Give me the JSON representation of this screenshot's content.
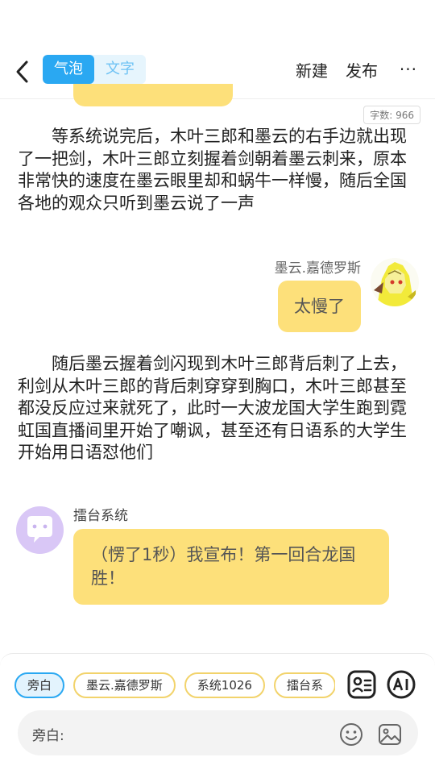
{
  "header": {
    "back_icon": "chevron-left-icon",
    "toggle": {
      "active": "气泡",
      "inactive": "文字"
    },
    "new_label": "新建",
    "publish_label": "发布",
    "more_label": "···"
  },
  "word_count": "字数: 966",
  "narration": [
    "等系统说完后，木叶三郎和墨云的右手边就出现了一把剑，木叶三郎立刻握着剑朝着墨云刺来，原本非常快的速度在墨云眼里却和蜗牛一样慢，随后全国各地的观众只听到墨云说了一声",
    "随后墨云握着剑闪现到木叶三郎背后刺了上去，利剑从木叶三郎的背后刺穿穿到胸口，木叶三郎甚至都没反应过来就死了，此时一大波龙国大学生跑到霓虹国直播间里开始了嘲讽，甚至还有日语系的大学生开始用日语怼他们"
  ],
  "messages": [
    {
      "name": "墨云.嘉德罗斯",
      "text": "太慢了",
      "side": "right"
    },
    {
      "name": "擂台系统",
      "text": "（愣了1秒）我宣布！第一回合龙国胜！",
      "side": "left"
    }
  ],
  "chips": [
    {
      "label": "旁白",
      "selected": true
    },
    {
      "label": "墨云.嘉德罗斯",
      "selected": false
    },
    {
      "label": "系统1026",
      "selected": false
    },
    {
      "label": "擂台系",
      "selected": false
    }
  ],
  "input": {
    "label": "旁白:"
  },
  "colors": {
    "accent": "#2aa8f2",
    "bubble": "#fde07a",
    "system_avatar": "#d9c7f6"
  }
}
